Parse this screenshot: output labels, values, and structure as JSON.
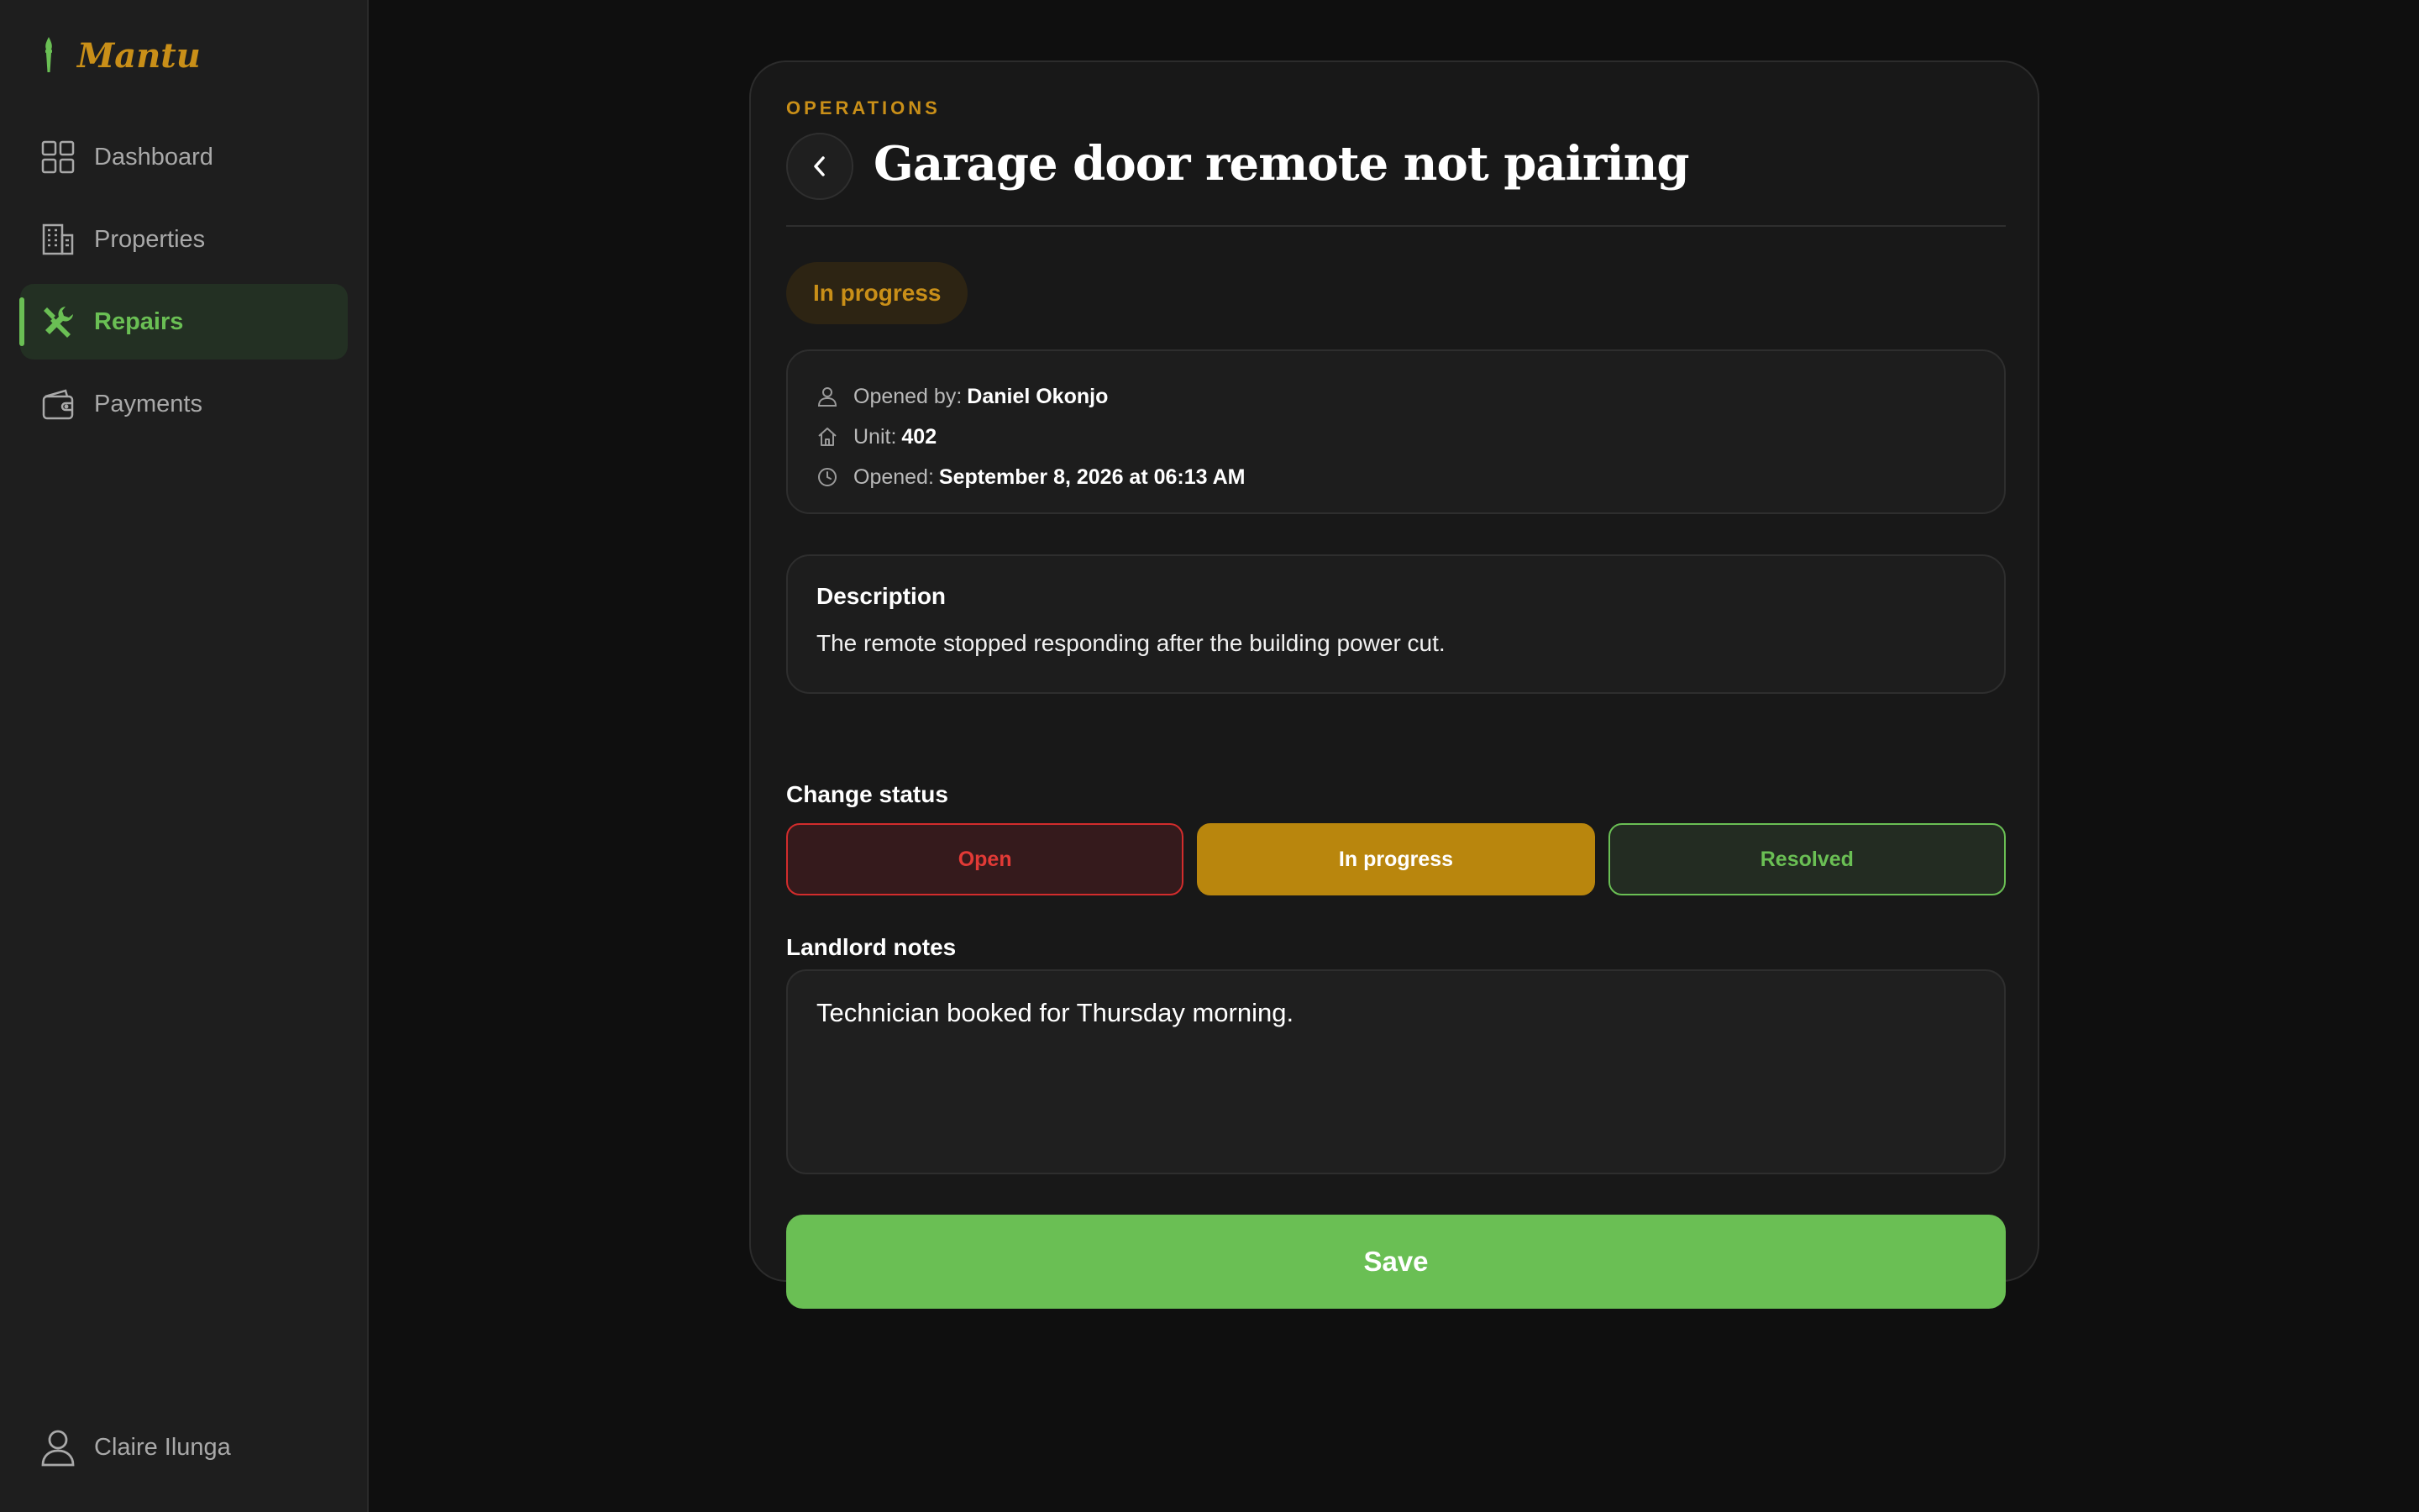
{
  "app": {
    "name": "Mantu"
  },
  "sidebar": {
    "items": [
      {
        "label": "Dashboard",
        "icon": "grid-icon",
        "active": false
      },
      {
        "label": "Properties",
        "icon": "building-icon",
        "active": false
      },
      {
        "label": "Repairs",
        "icon": "tools-icon",
        "active": true
      },
      {
        "label": "Payments",
        "icon": "wallet-icon",
        "active": false
      }
    ],
    "user": "Claire Ilunga"
  },
  "page": {
    "eyebrow": "OPERATIONS",
    "title": "Garage door remote not pairing",
    "status": "In progress"
  },
  "meta": {
    "opened_by_label": "Opened by:",
    "opened_by": "Daniel Okonjo",
    "unit_label": "Unit:",
    "unit": "402",
    "opened_label": "Opened:",
    "opened": "September 8, 2026 at 06:13 AM"
  },
  "description": {
    "title": "Description",
    "text": "The remote stopped responding after the building power cut."
  },
  "change_status": {
    "label": "Change status",
    "options": [
      "Open",
      "In progress",
      "Resolved"
    ],
    "selected": "In progress"
  },
  "notes": {
    "label": "Landlord notes",
    "value": "Technician booked for Thursday morning."
  },
  "save_label": "Save",
  "colors": {
    "accent_green": "#6abf54",
    "accent_amber": "#c98f18",
    "danger_red": "#d22c2c",
    "background": "#0f0f0f",
    "sidebar": "#1e1e1e"
  }
}
